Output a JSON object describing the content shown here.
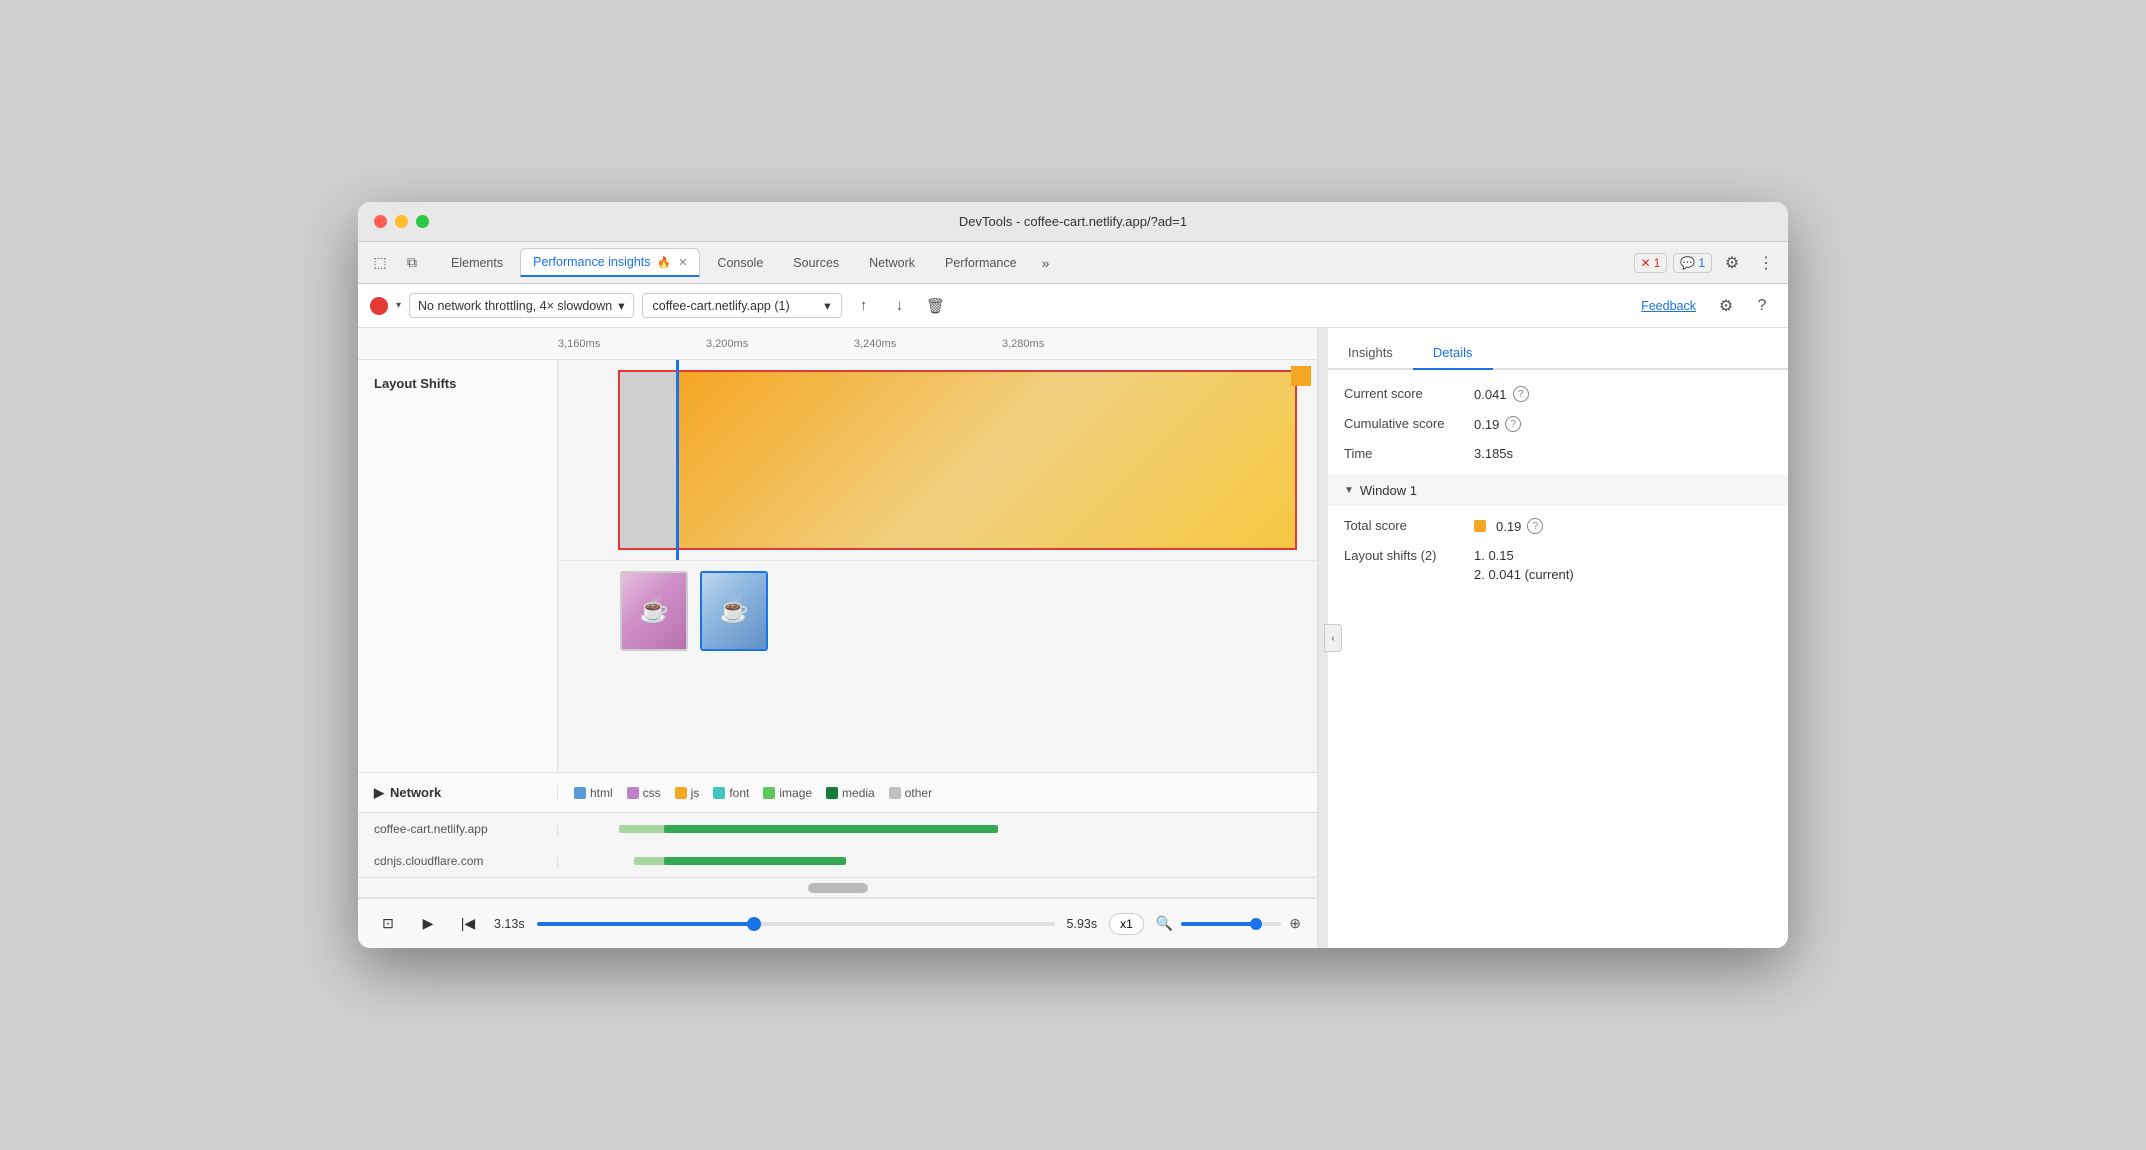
{
  "window": {
    "title": "DevTools - coffee-cart.netlify.app/?ad=1"
  },
  "tabs": {
    "items": [
      {
        "label": "Elements",
        "active": false
      },
      {
        "label": "Performance insights",
        "active": true,
        "has_flame": true
      },
      {
        "label": "Console",
        "active": false
      },
      {
        "label": "Sources",
        "active": false
      },
      {
        "label": "Network",
        "active": false
      },
      {
        "label": "Performance",
        "active": false
      }
    ],
    "more_label": "»",
    "error_badge": "1",
    "info_badge": "1"
  },
  "toolbar": {
    "throttle": "No network throttling, 4× slowdown",
    "url": "coffee-cart.netlify.app (1)",
    "feedback_label": "Feedback"
  },
  "timeline": {
    "markers": [
      "3,160ms",
      "3,200ms",
      "3,240ms",
      "3,280ms"
    ]
  },
  "layout_shifts": {
    "label": "Layout Shifts"
  },
  "network": {
    "label": "Network",
    "legend": [
      {
        "type": "html",
        "color": "#5b9bd5",
        "label": "html"
      },
      {
        "type": "css",
        "color": "#c080c8",
        "label": "css"
      },
      {
        "type": "js",
        "color": "#f5a623",
        "label": "js"
      },
      {
        "type": "font",
        "color": "#40c4c4",
        "label": "font"
      },
      {
        "type": "image",
        "color": "#5bc85b",
        "label": "image"
      },
      {
        "type": "media",
        "color": "#1a7a3a",
        "label": "media"
      },
      {
        "type": "other",
        "color": "#c0c0c0",
        "label": "other"
      }
    ],
    "rows": [
      {
        "label": "coffee-cart.netlify.app",
        "bar_left": "8%",
        "bar_light_width": "8%",
        "bar_width": "42%"
      },
      {
        "label": "cdnjs.cloudflare.com",
        "bar_left": "12%",
        "bar_light_width": "6%",
        "bar_width": "24%"
      }
    ]
  },
  "playback": {
    "start_time": "3.13s",
    "end_time": "5.93s",
    "speed": "x1",
    "slider_position": "42"
  },
  "right_panel": {
    "tabs": [
      {
        "label": "Insights",
        "active": false
      },
      {
        "label": "Details",
        "active": true
      }
    ],
    "details": {
      "current_score_label": "Current score",
      "current_score_value": "0.041",
      "cumulative_score_label": "Cumulative score",
      "cumulative_score_value": "0.19",
      "time_label": "Time",
      "time_value": "3.185s",
      "window1_label": "Window 1",
      "total_score_label": "Total score",
      "total_score_value": "0.19",
      "layout_shifts_label": "Layout shifts (2)",
      "layout_shift_1": "1. 0.15",
      "layout_shift_2": "2. 0.041 (current)"
    }
  }
}
